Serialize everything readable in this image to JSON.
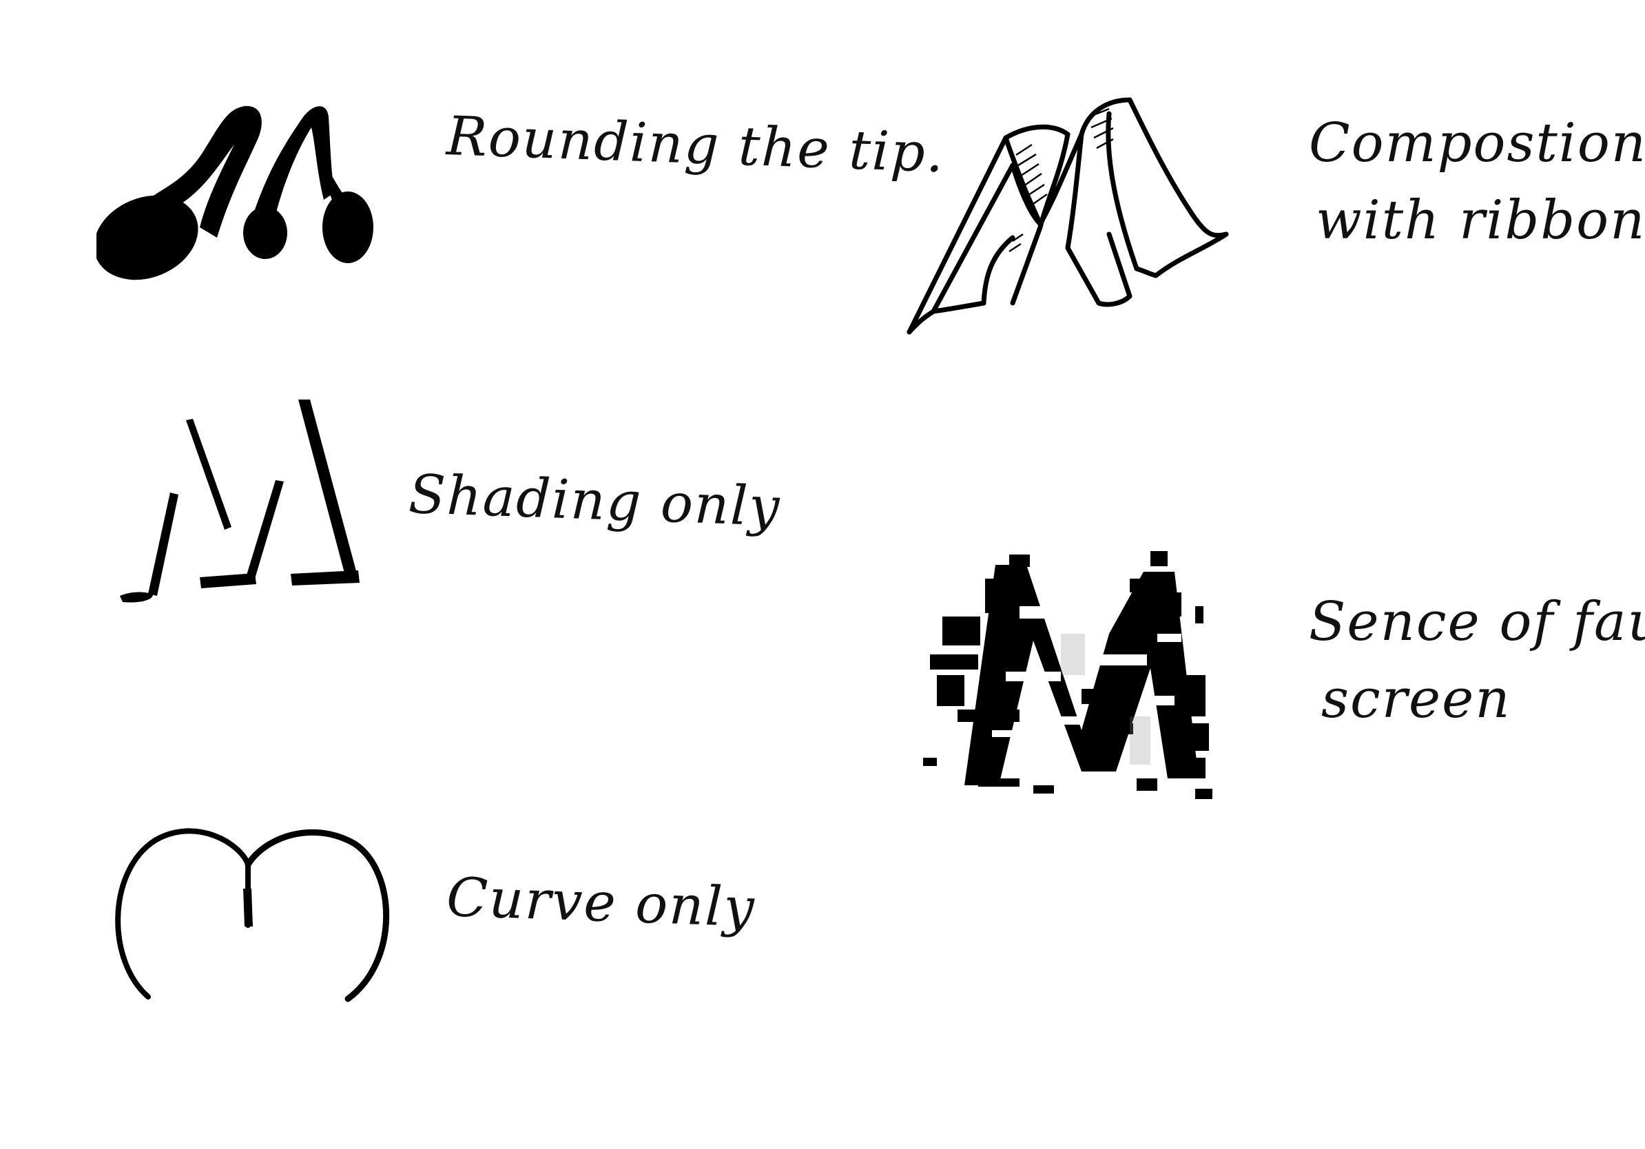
{
  "notes": {
    "rounding": "Rounding the tip.",
    "shading": "Shading only",
    "curve": "Curve only",
    "ribbon_line1": "Compostion",
    "ribbon_line2": "with ribbon",
    "fault_line1": "Sence of fault",
    "fault_line2": "screen"
  },
  "sketches": [
    {
      "name": "rounded-tip-m",
      "icon": "m-letter-rounded-tips"
    },
    {
      "name": "shading-only-m",
      "icon": "m-letter-shading-strokes"
    },
    {
      "name": "curve-only-m",
      "icon": "m-letter-curves"
    },
    {
      "name": "ribbon-m",
      "icon": "m-letter-ribbon"
    },
    {
      "name": "glitch-m",
      "icon": "m-letter-glitch"
    }
  ],
  "colors": {
    "ink": "#000000",
    "paper": "#ffffff"
  }
}
